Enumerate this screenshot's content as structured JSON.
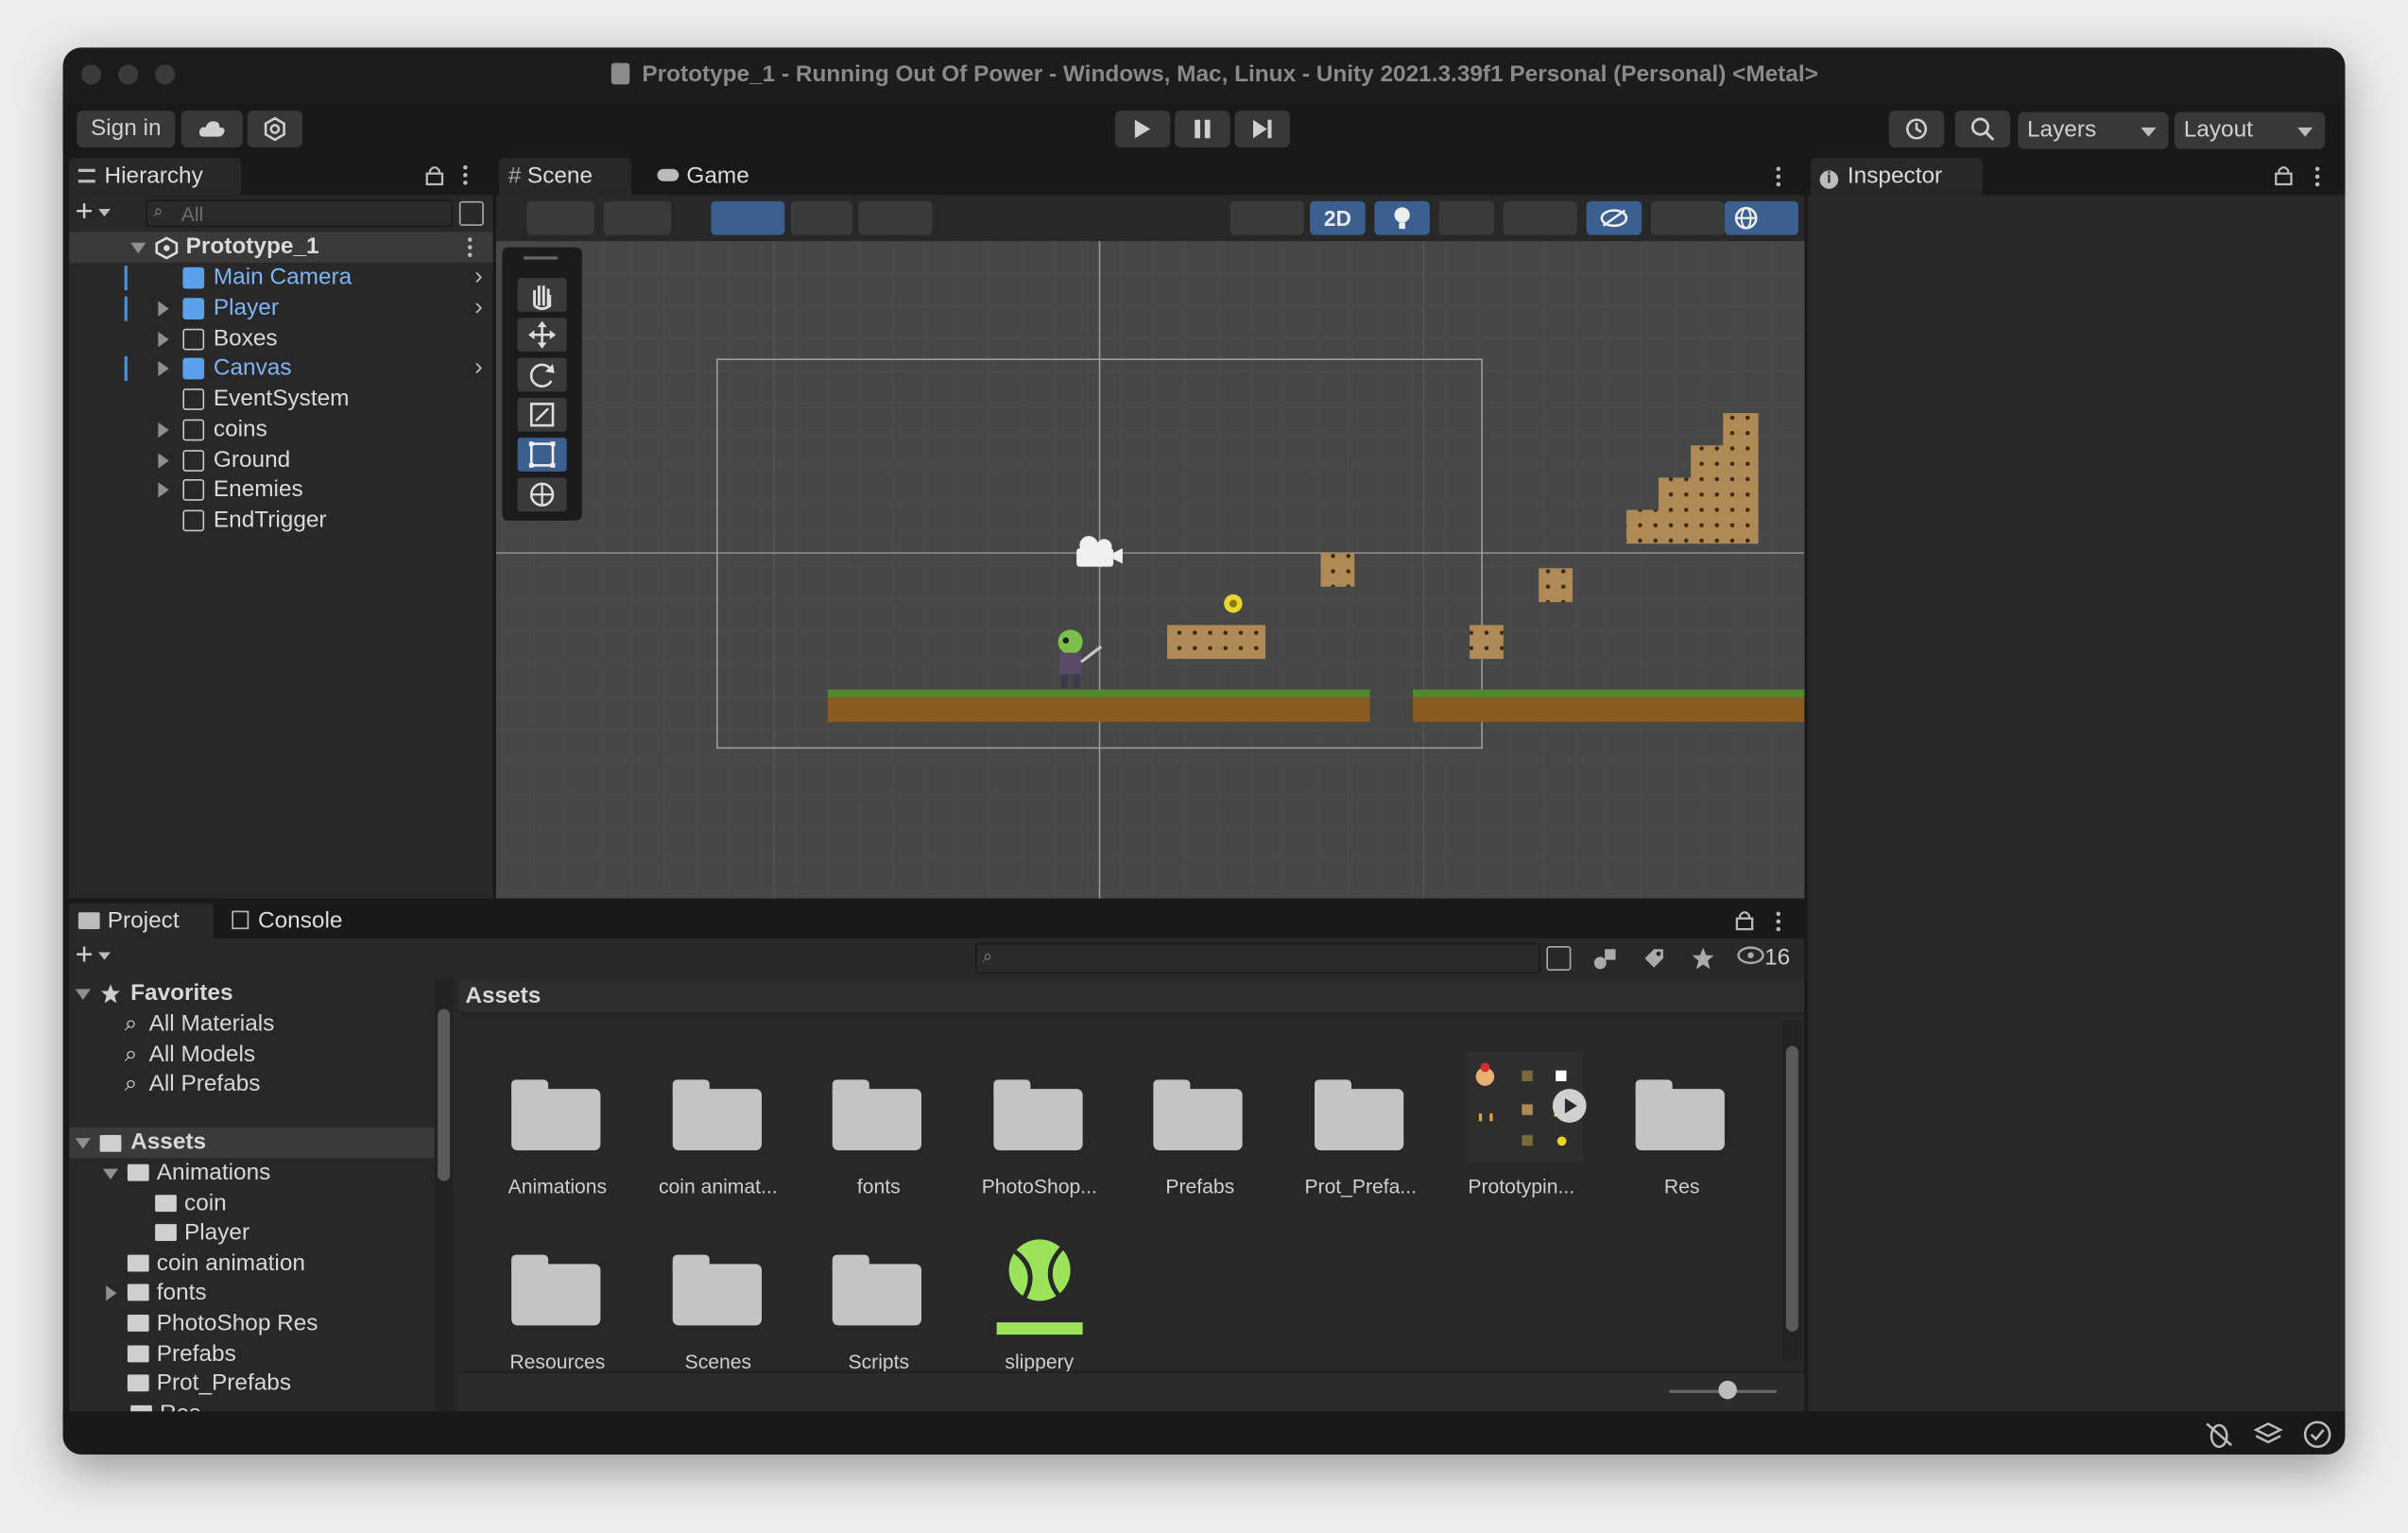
{
  "window": {
    "title": "Prototype_1 - Running Out Of Power - Windows, Mac, Linux - Unity 2021.3.39f1 Personal (Personal) <Metal>"
  },
  "toolbar": {
    "sign_in": "Sign in",
    "layers": "Layers",
    "layout": "Layout"
  },
  "hierarchy": {
    "tab": "Hierarchy",
    "search_placeholder": "All",
    "scene": "Prototype_1",
    "items": [
      {
        "label": "Main Camera",
        "blue": true,
        "expandable": false
      },
      {
        "label": "Player",
        "blue": true,
        "expandable": true
      },
      {
        "label": "Boxes",
        "blue": false,
        "expandable": true
      },
      {
        "label": "Canvas",
        "blue": true,
        "expandable": true
      },
      {
        "label": "EventSystem",
        "blue": false,
        "expandable": false
      },
      {
        "label": "coins",
        "blue": false,
        "expandable": true
      },
      {
        "label": "Ground",
        "blue": false,
        "expandable": true
      },
      {
        "label": "Enemies",
        "blue": false,
        "expandable": true
      },
      {
        "label": "EndTrigger",
        "blue": false,
        "expandable": false
      }
    ]
  },
  "scene_view": {
    "tab_scene": "Scene",
    "tab_game": "Game",
    "mode_2d": "2D"
  },
  "inspector": {
    "tab": "Inspector"
  },
  "project": {
    "tab_project": "Project",
    "tab_console": "Console",
    "visible_count": "16",
    "favorites": {
      "label": "Favorites",
      "items": [
        "All Materials",
        "All Models",
        "All Prefabs"
      ]
    },
    "assets_tree": {
      "label": "Assets",
      "items": [
        {
          "label": "Animations",
          "indent": 1,
          "expanded": true
        },
        {
          "label": "coin",
          "indent": 2
        },
        {
          "label": "Player",
          "indent": 2
        },
        {
          "label": "coin animation",
          "indent": 1
        },
        {
          "label": "fonts",
          "indent": 1,
          "expandable": true
        },
        {
          "label": "PhotoShop Res",
          "indent": 1
        },
        {
          "label": "Prefabs",
          "indent": 1
        },
        {
          "label": "Prot_Prefabs",
          "indent": 1
        }
      ],
      "partial_item": "Res"
    },
    "breadcrumb": "Assets",
    "grid_row1": [
      "Animations",
      "coin animat...",
      "fonts",
      "PhotoShop...",
      "Prefabs",
      "Prot_Prefa...",
      "Prototypin...",
      "Res"
    ],
    "grid_row2": [
      "Resources",
      "Scenes",
      "Scripts",
      "slippery"
    ]
  },
  "colors": {
    "accent_blue": "#7fb4f5",
    "ground_brown": "#8a5a1e",
    "ground_green": "#4e8a2c",
    "crate": "#b08a56",
    "slippery_green": "#9be45a"
  }
}
